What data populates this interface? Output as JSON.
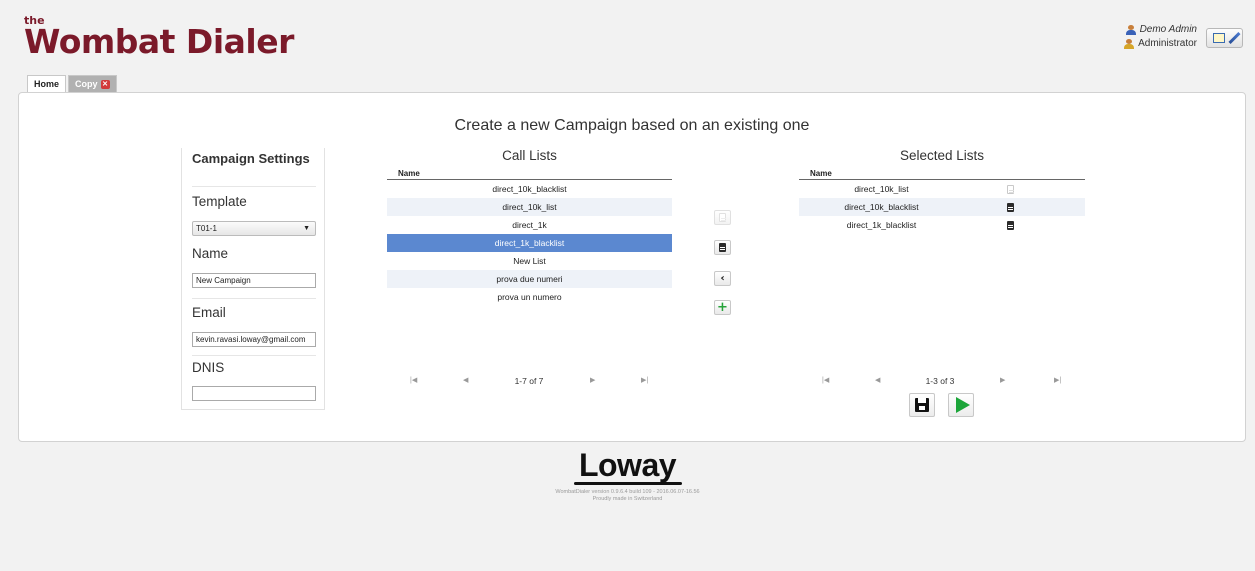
{
  "app": {
    "logo_the": "the",
    "logo_name": "Wombat Dialer"
  },
  "user": {
    "name": "Demo Admin",
    "role": "Administrator"
  },
  "tabs": [
    {
      "label": "Home"
    },
    {
      "label": "Copy"
    }
  ],
  "page": {
    "title": "Create a new Campaign based on an existing one"
  },
  "settings": {
    "title": "Campaign Settings",
    "template_label": "Template",
    "template_value": "T01-1",
    "name_label": "Name",
    "name_value": "New Campaign",
    "email_label": "Email",
    "email_value": "kevin.ravasi.loway@gmail.com",
    "dnis_label": "DNIS",
    "dnis_value": ""
  },
  "call_lists": {
    "title": "Call Lists",
    "column": "Name",
    "rows": [
      "direct_10k_blacklist",
      "direct_10k_list",
      "direct_1k",
      "direct_1k_blacklist",
      "New List",
      "prova due numeri",
      "prova un numero"
    ],
    "selected_row": "direct_1k_blacklist",
    "pager": "1-7 of 7"
  },
  "selected_lists": {
    "title": "Selected Lists",
    "column": "Name",
    "rows": [
      "direct_10k_list",
      "direct_10k_blacklist",
      "direct_1k_blacklist"
    ],
    "pager": "1-3 of 3"
  },
  "icons": {
    "user": "user-icon",
    "admin": "administrator-icon",
    "window": "window-icon",
    "pencil": "pencil-icon",
    "close": "close-icon",
    "document": "document-icon",
    "left": "chevron-left-icon",
    "add": "plus-icon",
    "save": "save-icon",
    "run": "play-icon"
  },
  "colors": {
    "brand": "#7b1a2a",
    "selection": "#5b88d0",
    "run": "#1ca53a"
  },
  "footer": {
    "logo": "Loway",
    "version": "WombatDialer version 0.9.6.4 build 109 - 2016.06.07-16.56",
    "tagline": "Proudly made in Switzerland"
  }
}
